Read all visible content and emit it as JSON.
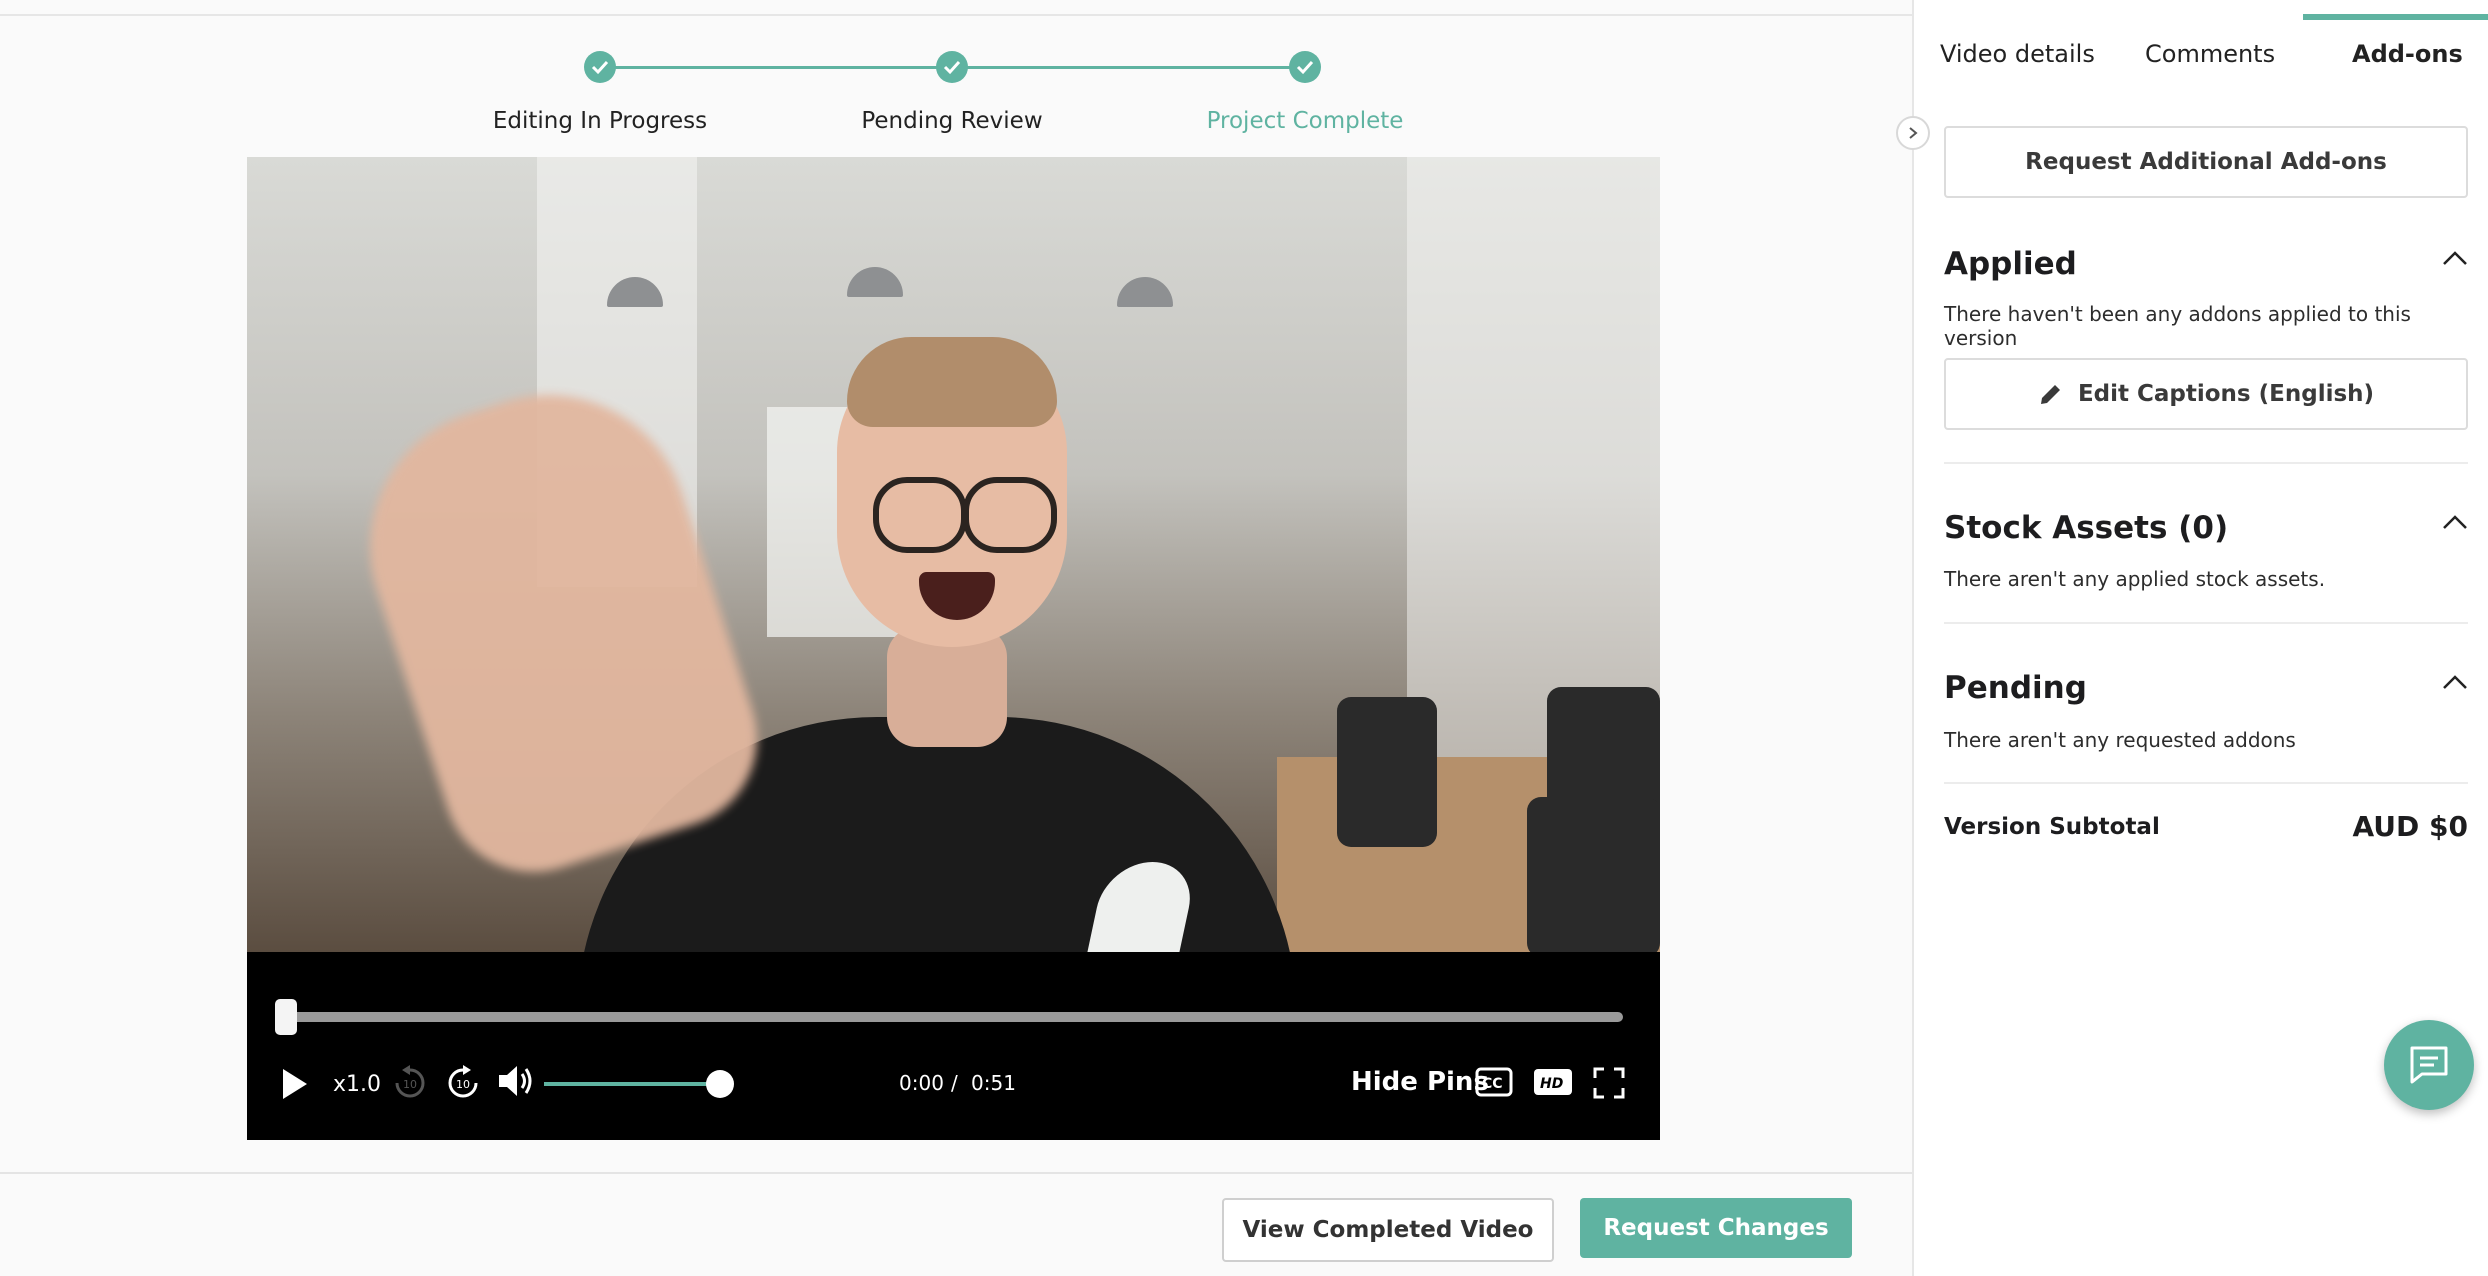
{
  "stepper": {
    "steps": [
      {
        "label": "Editing In Progress",
        "done": true
      },
      {
        "label": "Pending Review",
        "done": true
      },
      {
        "label": "Project Complete",
        "done": true,
        "active": true
      }
    ]
  },
  "player": {
    "speed": "x1.0",
    "current_time": "0:00",
    "separator": "/",
    "duration": "0:51",
    "hide_pins_label": "Hide Pins",
    "progress_fraction": 0.0,
    "volume_fraction": 1.0
  },
  "actions": {
    "view_completed": "View Completed Video",
    "request_changes": "Request Changes"
  },
  "sidebar": {
    "tabs": [
      {
        "label": "Video details"
      },
      {
        "label": "Comments"
      },
      {
        "label": "Add-ons",
        "active": true
      }
    ],
    "request_addons_label": "Request Additional Add-ons",
    "applied": {
      "title": "Applied",
      "text": "There haven't been any addons applied to this version",
      "edit_captions_label": "Edit Captions (English)"
    },
    "stock": {
      "title": "Stock Assets (0)",
      "text": "There aren't any applied stock assets."
    },
    "pending": {
      "title": "Pending",
      "text": "There aren't any requested addons"
    },
    "subtotal": {
      "label": "Version Subtotal",
      "value": "AUD $0"
    }
  },
  "colors": {
    "accent": "#5fb3a1"
  }
}
